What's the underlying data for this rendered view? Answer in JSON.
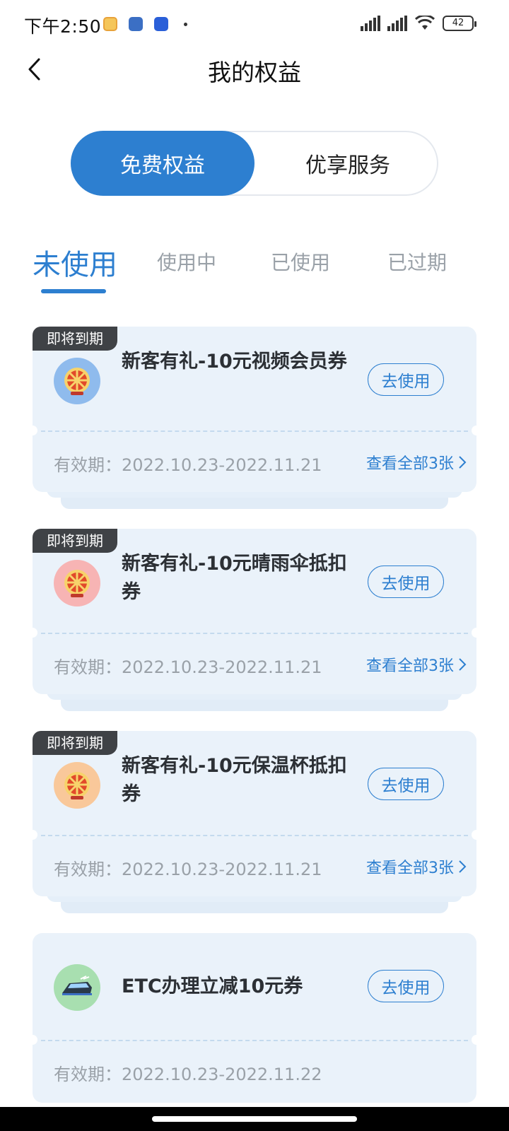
{
  "status_bar": {
    "time": "下午2:50",
    "battery": "42"
  },
  "header": {
    "title": "我的权益"
  },
  "segment": {
    "options": [
      "免费权益",
      "优享服务"
    ]
  },
  "tabs": [
    "未使用",
    "使用中",
    "已使用",
    "已过期"
  ],
  "coupons": [
    {
      "tag": "即将到期",
      "title": "新客有礼-10元视频会员券",
      "button": "去使用",
      "validity": "有效期：2022.10.23-2022.11.21",
      "view_all": "查看全部3张",
      "icon": "prize-wheel-icon"
    },
    {
      "tag": "即将到期",
      "title": "新客有礼-10元晴雨伞抵扣券",
      "button": "去使用",
      "validity": "有效期：2022.10.23-2022.11.21",
      "view_all": "查看全部3张",
      "icon": "prize-wheel-icon"
    },
    {
      "tag": "即将到期",
      "title": "新客有礼-10元保温杯抵扣券",
      "button": "去使用",
      "validity": "有效期：2022.10.23-2022.11.21",
      "view_all": "查看全部3张",
      "icon": "prize-wheel-icon"
    },
    {
      "title": "ETC办理立减10元券",
      "button": "去使用",
      "validity": "有效期：2022.10.23-2022.11.22",
      "icon": "train-icon"
    }
  ],
  "colors": {
    "accent": "#2d7fd0",
    "card_bg": "#eaf2fa",
    "tag_bg": "#3f4246"
  }
}
